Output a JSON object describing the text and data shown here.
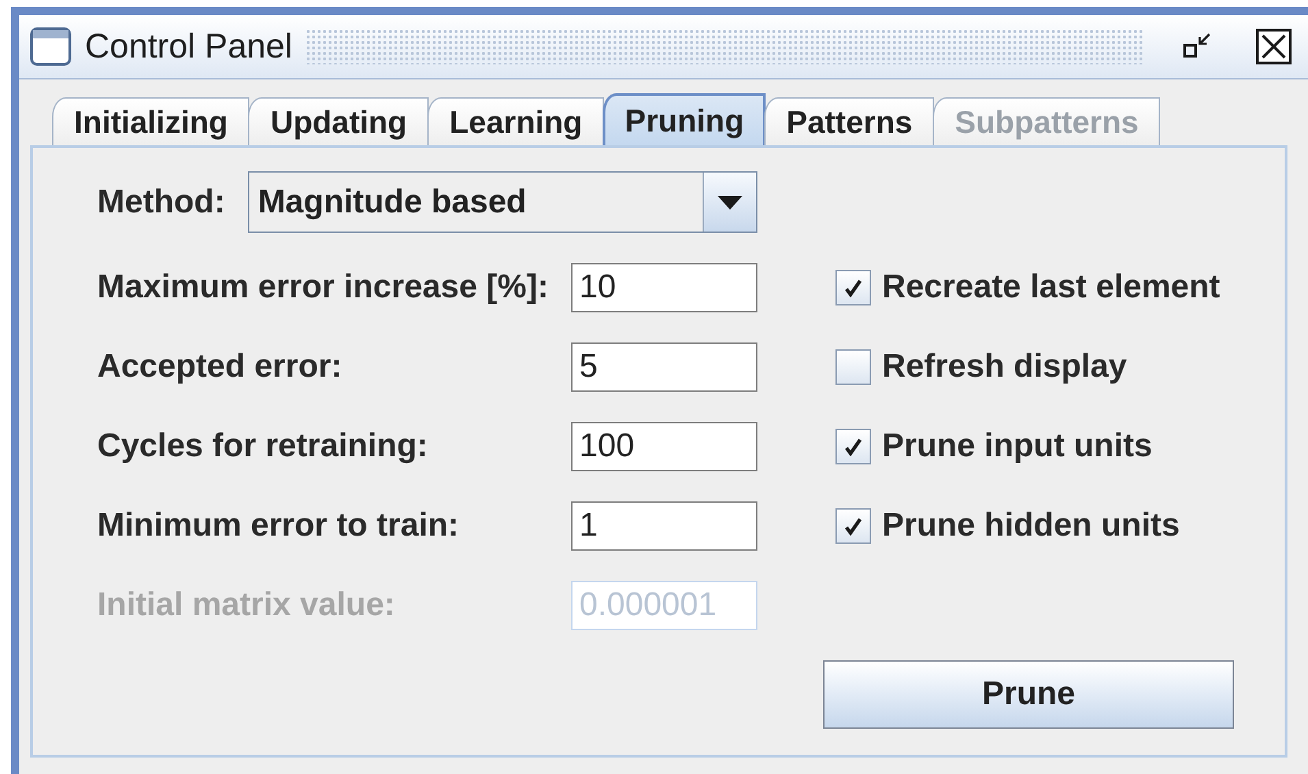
{
  "window": {
    "title": "Control Panel"
  },
  "tabs": [
    {
      "label": "Initializing",
      "selected": false,
      "disabled": false
    },
    {
      "label": "Updating",
      "selected": false,
      "disabled": false
    },
    {
      "label": "Learning",
      "selected": false,
      "disabled": false
    },
    {
      "label": "Pruning",
      "selected": true,
      "disabled": false
    },
    {
      "label": "Patterns",
      "selected": false,
      "disabled": false
    },
    {
      "label": "Subpatterns",
      "selected": false,
      "disabled": true
    }
  ],
  "method": {
    "label": "Method:",
    "value": "Magnitude based"
  },
  "parameters": [
    {
      "label": "Maximum error increase [%]:",
      "value": "10",
      "disabled": false
    },
    {
      "label": "Accepted error:",
      "value": "5",
      "disabled": false
    },
    {
      "label": "Cycles for retraining:",
      "value": "100",
      "disabled": false
    },
    {
      "label": "Minimum error to train:",
      "value": "1",
      "disabled": false
    },
    {
      "label": "Initial matrix value:",
      "value": "0.000001",
      "disabled": true
    }
  ],
  "options": [
    {
      "label": "Recreate last element",
      "checked": true
    },
    {
      "label": "Refresh display",
      "checked": false
    },
    {
      "label": "Prune input units",
      "checked": true
    },
    {
      "label": "Prune hidden units",
      "checked": true
    }
  ],
  "button": "Prune"
}
